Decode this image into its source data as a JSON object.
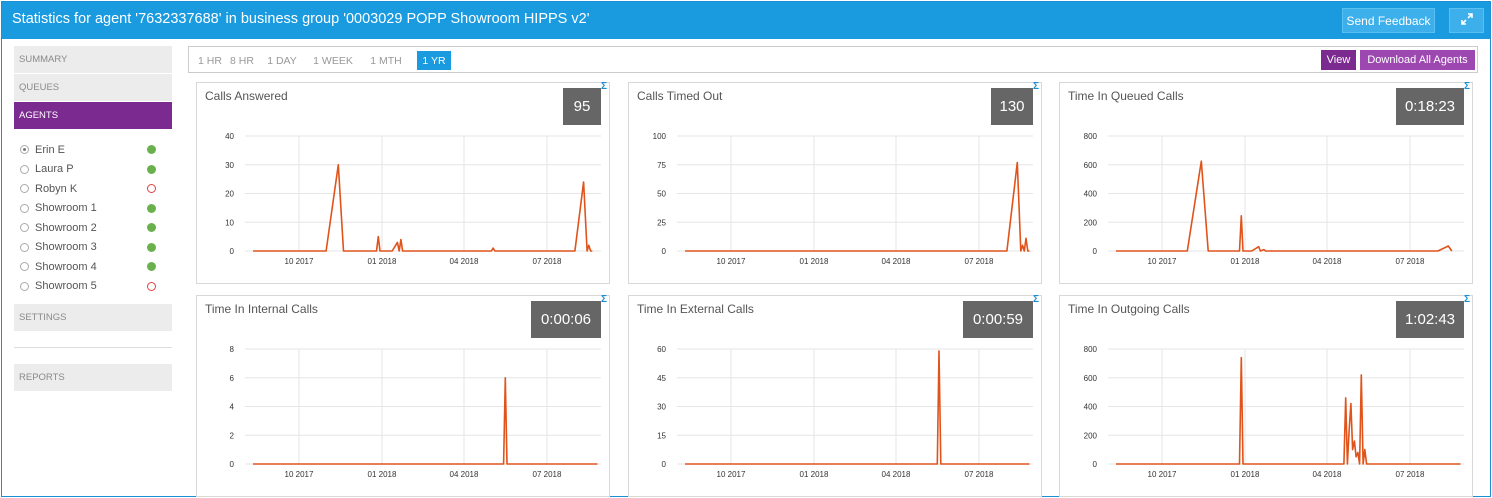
{
  "header": {
    "title": "Statistics for agent '7632337688' in business group '0003029 POPP Showroom HIPPS v2'",
    "send_feedback": "Send Feedback",
    "expand_icon": "expand-icon"
  },
  "sidebar": {
    "summary": "SUMMARY",
    "queues": "QUEUES",
    "agents": "AGENTS",
    "settings": "SETTINGS",
    "reports": "REPORTS",
    "agent_list": [
      {
        "name": "Erin E",
        "selected": true,
        "status": "online"
      },
      {
        "name": "Laura P",
        "selected": false,
        "status": "online"
      },
      {
        "name": "Robyn K",
        "selected": false,
        "status": "offline"
      },
      {
        "name": "Showroom 1",
        "selected": false,
        "status": "online"
      },
      {
        "name": "Showroom 2",
        "selected": false,
        "status": "online"
      },
      {
        "name": "Showroom 3",
        "selected": false,
        "status": "online"
      },
      {
        "name": "Showroom 4",
        "selected": false,
        "status": "online"
      },
      {
        "name": "Showroom 5",
        "selected": false,
        "status": "offline"
      }
    ]
  },
  "ranges": [
    "1 HR",
    "8 HR",
    "1 DAY",
    "1 WEEK",
    "1 MTH",
    "1 YR"
  ],
  "active_range": "1 YR",
  "toolbar": {
    "view": "View",
    "download": "Download All Agents"
  },
  "colors": {
    "accent": "#1a9be0",
    "purple": "#7b2a8f",
    "line": "#e0531a",
    "stat_bg": "#666666"
  },
  "chart_data": [
    {
      "type": "line",
      "title": "Calls Answered",
      "stat": "95",
      "x_ticks": [
        "10 2017",
        "01 2018",
        "04 2018",
        "07 2018"
      ],
      "y_ticks": [
        0,
        10,
        20,
        30,
        40
      ],
      "ylim": [
        0,
        40
      ],
      "points": [
        [
          0,
          0
        ],
        [
          0.21,
          0
        ],
        [
          0.245,
          30
        ],
        [
          0.26,
          0
        ],
        [
          0.355,
          0
        ],
        [
          0.36,
          5
        ],
        [
          0.365,
          0
        ],
        [
          0.4,
          0
        ],
        [
          0.415,
          3
        ],
        [
          0.42,
          0
        ],
        [
          0.425,
          4
        ],
        [
          0.43,
          0
        ],
        [
          0.685,
          0
        ],
        [
          0.69,
          1
        ],
        [
          0.695,
          0
        ],
        [
          0.925,
          0
        ],
        [
          0.95,
          24
        ],
        [
          0.96,
          0
        ],
        [
          0.965,
          2
        ],
        [
          0.97,
          0
        ],
        [
          0.975,
          0
        ]
      ]
    },
    {
      "type": "line",
      "title": "Calls Timed Out",
      "stat": "130",
      "x_ticks": [
        "10 2017",
        "01 2018",
        "04 2018",
        "07 2018"
      ],
      "y_ticks": [
        0,
        25,
        50,
        75,
        100
      ],
      "ylim": [
        0,
        100
      ],
      "points": [
        [
          0,
          0
        ],
        [
          0.925,
          0
        ],
        [
          0.955,
          77
        ],
        [
          0.965,
          0
        ],
        [
          0.97,
          5
        ],
        [
          0.975,
          0
        ],
        [
          0.98,
          11
        ],
        [
          0.985,
          0
        ],
        [
          0.99,
          0
        ]
      ]
    },
    {
      "type": "line",
      "title": "Time In Queued Calls",
      "stat": "0:18:23",
      "x_ticks": [
        "10 2017",
        "01 2018",
        "04 2018",
        "07 2018"
      ],
      "y_ticks": [
        0,
        200,
        400,
        600,
        800
      ],
      "ylim": [
        0,
        800
      ],
      "points": [
        [
          0,
          0
        ],
        [
          0.205,
          0
        ],
        [
          0.245,
          625
        ],
        [
          0.265,
          0
        ],
        [
          0.355,
          0
        ],
        [
          0.36,
          245
        ],
        [
          0.365,
          0
        ],
        [
          0.39,
          0
        ],
        [
          0.41,
          30
        ],
        [
          0.415,
          0
        ],
        [
          0.425,
          10
        ],
        [
          0.43,
          0
        ],
        [
          0.925,
          0
        ],
        [
          0.955,
          35
        ],
        [
          0.965,
          0
        ]
      ]
    },
    {
      "type": "line",
      "title": "Time In Internal Calls",
      "stat": "0:00:06",
      "x_ticks": [
        "10 2017",
        "01 2018",
        "04 2018",
        "07 2018"
      ],
      "y_ticks": [
        0,
        2,
        4,
        6,
        8
      ],
      "ylim": [
        0,
        8
      ],
      "points": [
        [
          0,
          0
        ],
        [
          0.72,
          0
        ],
        [
          0.725,
          6
        ],
        [
          0.73,
          0
        ],
        [
          0.99,
          0
        ]
      ]
    },
    {
      "type": "line",
      "title": "Time In External Calls",
      "stat": "0:00:59",
      "x_ticks": [
        "10 2017",
        "01 2018",
        "04 2018",
        "07 2018"
      ],
      "y_ticks": [
        0,
        15,
        30,
        45,
        60
      ],
      "ylim": [
        0,
        60
      ],
      "points": [
        [
          0,
          0
        ],
        [
          0.725,
          0
        ],
        [
          0.73,
          59
        ],
        [
          0.735,
          0
        ],
        [
          0.99,
          0
        ]
      ]
    },
    {
      "type": "line",
      "title": "Time In Outgoing Calls",
      "stat": "1:02:43",
      "x_ticks": [
        "10 2017",
        "01 2018",
        "04 2018",
        "07 2018"
      ],
      "y_ticks": [
        0,
        200,
        400,
        600,
        800
      ],
      "ylim": [
        0,
        800
      ],
      "points": [
        [
          0,
          0
        ],
        [
          0.355,
          0
        ],
        [
          0.36,
          740
        ],
        [
          0.365,
          0
        ],
        [
          0.655,
          0
        ],
        [
          0.66,
          460
        ],
        [
          0.665,
          0
        ],
        [
          0.67,
          240
        ],
        [
          0.675,
          420
        ],
        [
          0.68,
          100
        ],
        [
          0.685,
          160
        ],
        [
          0.69,
          50
        ],
        [
          0.695,
          80
        ],
        [
          0.7,
          0
        ],
        [
          0.705,
          620
        ],
        [
          0.71,
          0
        ],
        [
          0.715,
          100
        ],
        [
          0.72,
          0
        ],
        [
          0.99,
          0
        ]
      ]
    }
  ]
}
